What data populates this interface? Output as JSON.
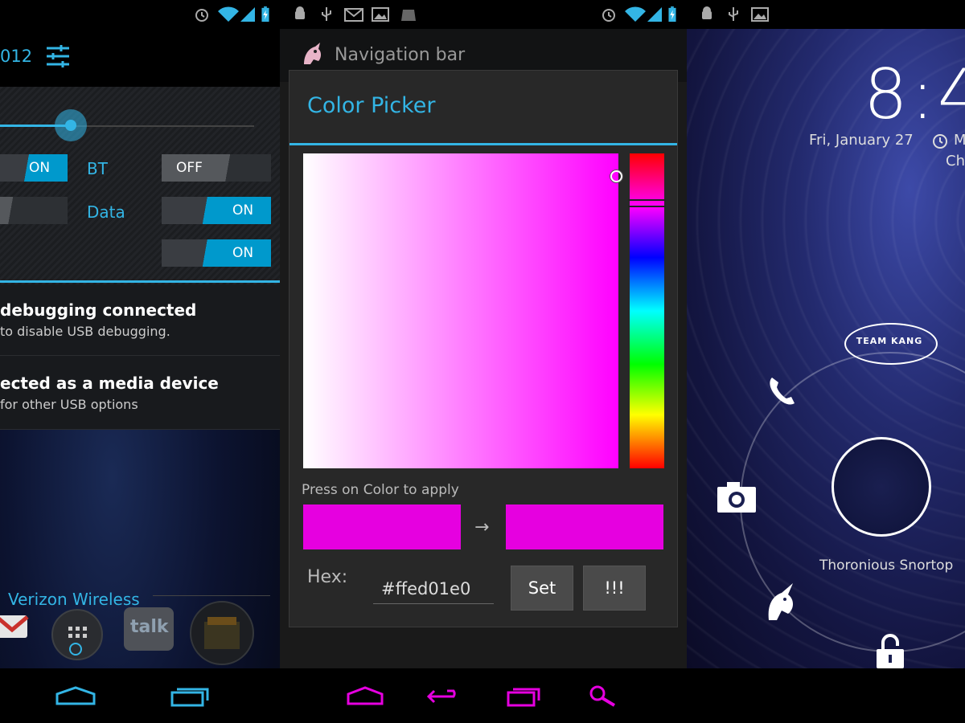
{
  "panel_left": {
    "header": {
      "date_fragment": "012",
      "settings_icon": "settings-sliders-icon"
    },
    "toggles": {
      "row1_left": "ON",
      "bt_label": "BT",
      "bt_state": "OFF",
      "data_label": "Data",
      "data_state": "ON",
      "row3_state": "ON"
    },
    "notifications": [
      {
        "title": "debugging connected",
        "subtitle": "to disable USB debugging."
      },
      {
        "title": "ected as a media device",
        "subtitle": "for other USB options"
      }
    ],
    "carrier": "Verizon Wireless",
    "dock_apps": [
      "gmail-icon",
      "app-drawer-icon",
      "talk-icon",
      "market-icon"
    ],
    "dock_talk_label": "talk"
  },
  "panel_middle": {
    "app_title": "Navigation bar",
    "dialog": {
      "title": "Color Picker",
      "instruction": "Press on Color to apply",
      "hex_label": "Hex:",
      "hex_value": "#ffed01e0",
      "set_button": "Set",
      "alert_button": "!!!",
      "arrow": "→"
    },
    "colors": {
      "old_color": "#e600e0",
      "new_color": "#e600e0",
      "accent": "#33b5e5",
      "nav_tint": "#e600e0"
    }
  },
  "panel_right": {
    "clock": "8:4",
    "date": "Fri, January 27",
    "alarm_fragment": "M",
    "alarm_sub": "Ch",
    "team_badge": "TEAM KANG",
    "owner": "Thoronious Snortop",
    "targets": [
      "phone-icon",
      "camera-icon",
      "unicorn-icon",
      "unlock-icon"
    ]
  }
}
